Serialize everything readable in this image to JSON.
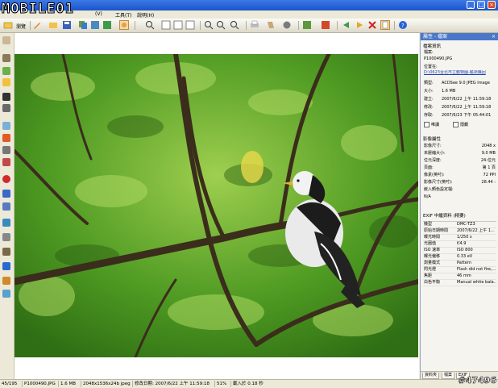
{
  "brand": {
    "logo": "MOBILE01"
  },
  "window": {
    "minimize": "_",
    "maximize": "□",
    "close": "×"
  },
  "menu": [
    {
      "label": "(V)"
    },
    {
      "label": "工具(T)"
    },
    {
      "label": "說明(H)"
    }
  ],
  "toolbar": {
    "browse_label": "瀏覽",
    "icons": [
      "browse-icon",
      "edit-icon",
      "folder-icon",
      "save-icon",
      "copy-icon",
      "move-icon",
      "rename-icon",
      "fullscreen-icon",
      "zoom-icon",
      "page-first-icon",
      "page-prev-icon",
      "page-next-icon",
      "page-last-icon",
      "zoom-in-icon",
      "zoom-out-icon",
      "zoom-fit-icon",
      "print-icon",
      "email-icon",
      "wallpaper-icon",
      "slideshow-icon",
      "rotate-icon",
      "share-icon",
      "prev-image-icon",
      "next-image-icon",
      "delete-icon",
      "properties-icon",
      "help-icon"
    ]
  },
  "panel": {
    "title": "屬性 - 檔案",
    "file_info_heading": "檔案資訊",
    "file_label": "檔案:",
    "file_name": "P1000490.JPG",
    "location_label": "位置在:",
    "location": "D:\\0623台北市立動物園-龜鴿購回",
    "info_rows": [
      {
        "k": "類型:",
        "v": "ACDSee 9.0 JPEG Image"
      },
      {
        "k": "大小:",
        "v": "1.6 MB"
      },
      {
        "k": "建立:",
        "v": "2007/6/22 上午 11:59:18"
      },
      {
        "k": "修改:",
        "v": "2007/6/22 上午 11:59:18"
      },
      {
        "k": "存取:",
        "v": "2007/6/23 下午 05:44:01"
      }
    ],
    "readonly_label": "唯讀",
    "hidden_label": "隱藏",
    "image_props_heading": "影像屬性",
    "image_rows": [
      {
        "k": "影像尺寸:",
        "v": "2048 x"
      },
      {
        "k": "未壓縮大小:",
        "v": "9.0 MB"
      },
      {
        "k": "位元深度:",
        "v": "24-位元"
      },
      {
        "k": "頁面:",
        "v": "第 1 頁"
      },
      {
        "k": "像素(英吋):",
        "v": "72 PPI"
      },
      {
        "k": "影像尺寸(英吋):",
        "v": "28.44 :"
      },
      {
        "k": "嵌入顏色設定檔:",
        "v": ""
      }
    ],
    "na_value": "N/A",
    "exif_heading": "EXIF 中繼資料 (精要)",
    "exif_rows": [
      {
        "k": "機型",
        "v": "DMC-TZ3"
      },
      {
        "k": "原始日期時間",
        "v": "2007/6/22 上午 1..."
      },
      {
        "k": "曝光時間",
        "v": "1/250 s"
      },
      {
        "k": "光圈值",
        "v": "f/4.9"
      },
      {
        "k": "ISO 速率",
        "v": "ISO 800"
      },
      {
        "k": "曝光偏移",
        "v": "0.33 eV"
      },
      {
        "k": "測量模式",
        "v": "Pattern"
      },
      {
        "k": "閃光燈",
        "v": "Flash did not fire,..."
      },
      {
        "k": "焦距",
        "v": "46 mm"
      },
      {
        "k": "白色平衡",
        "v": "Manual white bala..."
      }
    ],
    "tabs": [
      "資料夾",
      "檔案",
      "EXIF"
    ]
  },
  "status": {
    "index": "45/195",
    "filename": "P1000490.JPG",
    "size": "1.6 MB",
    "dims": "2048x1536x24b jpeg",
    "modified": "修改日期: 2007/6/22 上午 11:59:18",
    "zoom": "51%",
    "load": "載入於 0.18 秒"
  },
  "watermark": "#47496",
  "colors": {
    "title_blue": "#2a62d6",
    "panel_head": "#4a77c9",
    "foliage": "#4f9a25"
  }
}
